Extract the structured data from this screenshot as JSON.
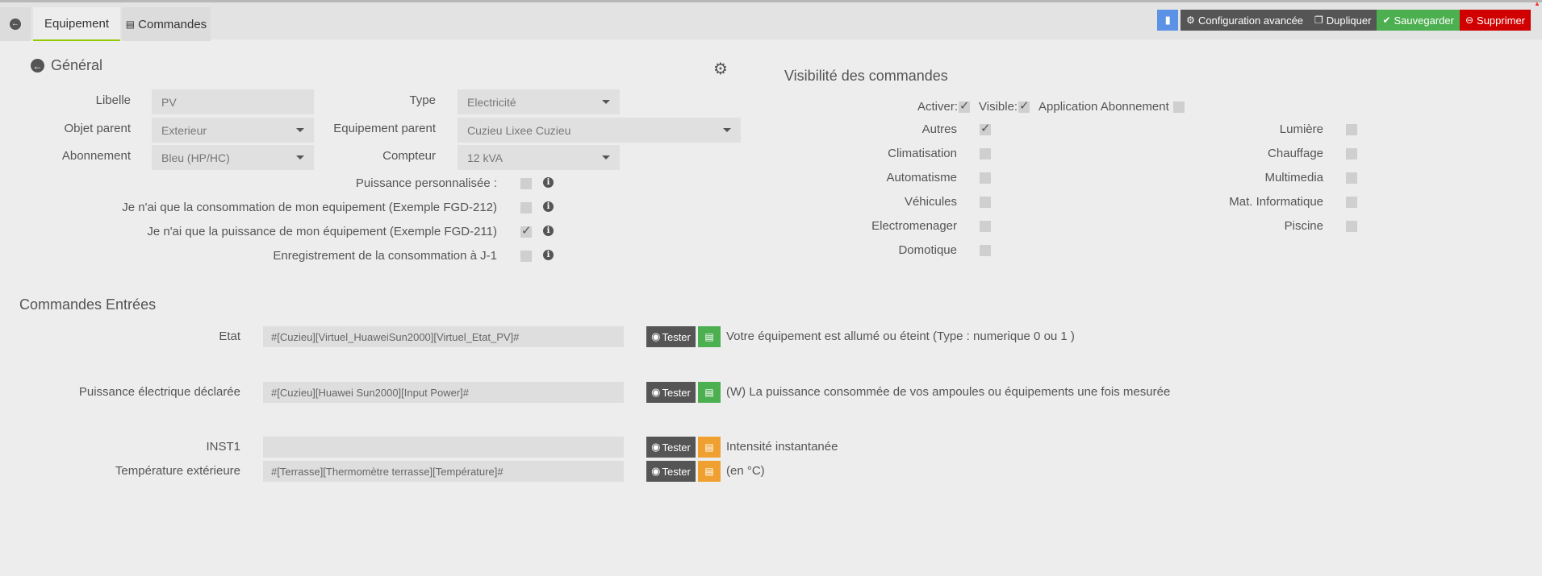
{
  "tabs": {
    "equipement": "Equipement",
    "commandes": "Commandes"
  },
  "toolbar": {
    "configuration": "Configuration avancée",
    "dupliquer": "Dupliquer",
    "sauvegarder": "Sauvegarder",
    "supprimer": "Supprimer"
  },
  "general": {
    "title": "Général",
    "libelle_label": "Libelle",
    "libelle_value": "PV",
    "type_label": "Type",
    "type_value": "Electricité",
    "objet_label": "Objet parent",
    "objet_value": "Exterieur",
    "equip_parent_label": "Equipement parent",
    "equip_parent_value": "Cuzieu Lixee Cuzieu",
    "abonnement_label": "Abonnement",
    "abonnement_value": "Bleu (HP/HC)",
    "compteur_label": "Compteur",
    "compteur_value": "12 kVA",
    "options": [
      {
        "label": "Puissance personnalisée :",
        "checked": false
      },
      {
        "label": "Je n'ai que la consommation de mon equipement (Exemple FGD-212)",
        "checked": false
      },
      {
        "label": "Je n'ai que la puissance de mon équipement (Exemple FGD-211)",
        "checked": true
      },
      {
        "label": "Enregistrement de la consommation à J-1",
        "checked": false
      }
    ]
  },
  "visibilite": {
    "title": "Visibilité des commandes",
    "activer": "Activer:",
    "visible": "Visible:",
    "application": "Application Abonnement :",
    "left": [
      "Autres",
      "Climatisation",
      "Automatisme",
      "Véhicules",
      "Electromenager",
      "Domotique"
    ],
    "right": [
      "Lumière",
      "Chauffage",
      "Multimedia",
      "Mat. Informatique",
      "Piscine"
    ]
  },
  "commandes": {
    "title": "Commandes Entrées",
    "tester": "Tester",
    "rows": [
      {
        "label": "Etat",
        "value": "#[Cuzieu][Virtuel_HuaweiSun2000][Virtuel_Etat_PV]#",
        "desc": "Votre équipement est allumé ou éteint (Type : numerique 0 ou 1 )",
        "color": "#4caf50"
      },
      {
        "label": "Puissance électrique déclarée",
        "value": "#[Cuzieu][Huawei Sun2000][Input Power]#",
        "desc": "(W) La puissance consommée de vos ampoules ou équipements une fois mesurée",
        "color": "#4caf50"
      },
      {
        "label": "INST1",
        "value": "",
        "desc": "Intensité instantanée",
        "color": "#f0a030"
      },
      {
        "label": "Température extérieure",
        "value": "#[Terrasse][Thermomètre terrasse][Température]#",
        "desc": "(en °C)",
        "color": "#f0a030"
      }
    ]
  }
}
